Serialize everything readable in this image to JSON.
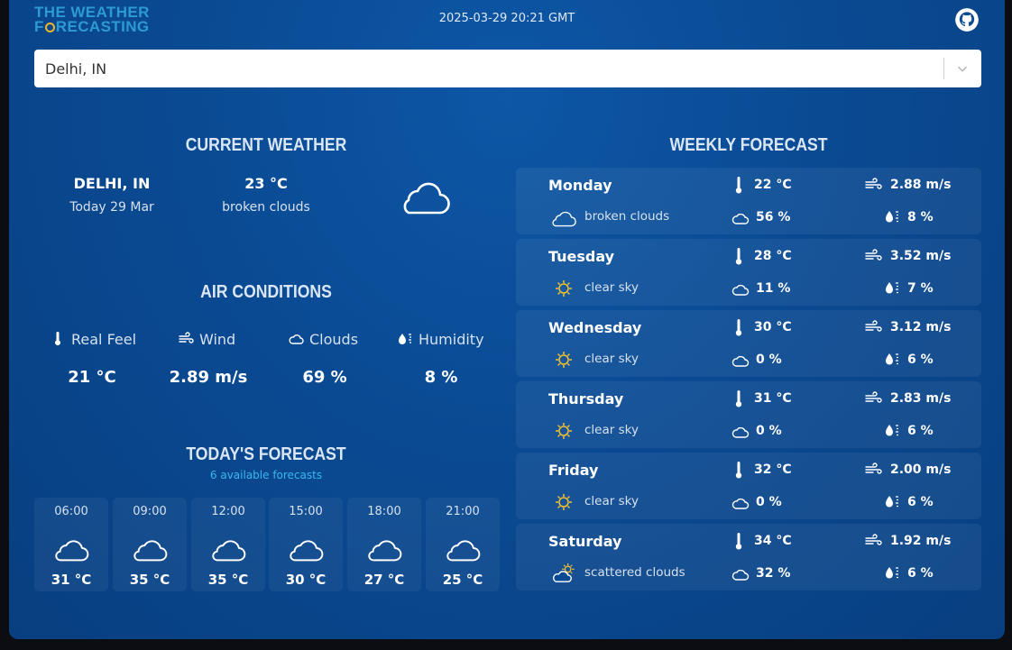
{
  "header": {
    "logo_line1": "THE WEATHER",
    "logo_line2_a": "F",
    "logo_line2_b": "RECASTING",
    "datetime": "2025-03-29 20:21 GMT",
    "github_icon": "github-icon"
  },
  "search": {
    "value": "Delhi, IN",
    "chevron_icon": "chevron-down-icon"
  },
  "current": {
    "title": "CURRENT WEATHER",
    "city": "DELHI, IN",
    "date": "Today 29 Mar",
    "temp": "23 °C",
    "description": "broken clouds",
    "icon": "cloud-icon"
  },
  "air": {
    "title": "AIR CONDITIONS",
    "items": [
      {
        "label": "Real Feel",
        "value": "21 °C",
        "icon": "thermometer-icon"
      },
      {
        "label": "Wind",
        "value": "2.89 m/s",
        "icon": "wind-icon"
      },
      {
        "label": "Clouds",
        "value": "69 %",
        "icon": "cloud-icon"
      },
      {
        "label": "Humidity",
        "value": "8 %",
        "icon": "humidity-icon"
      }
    ]
  },
  "today": {
    "title": "TODAY'S FORECAST",
    "subtitle": "6 available forecasts",
    "hours": [
      {
        "time": "06:00",
        "temp": "31 °C",
        "icon": "cloud-icon"
      },
      {
        "time": "09:00",
        "temp": "35 °C",
        "icon": "cloud-icon"
      },
      {
        "time": "12:00",
        "temp": "35 °C",
        "icon": "cloud-icon"
      },
      {
        "time": "15:00",
        "temp": "30 °C",
        "icon": "cloud-icon"
      },
      {
        "time": "18:00",
        "temp": "27 °C",
        "icon": "cloud-icon"
      },
      {
        "time": "21:00",
        "temp": "25 °C",
        "icon": "cloud-icon"
      }
    ]
  },
  "weekly": {
    "title": "WEEKLY FORECAST",
    "days": [
      {
        "name": "Monday",
        "temp": "22 °C",
        "wind": "2.88 m/s",
        "description": "broken clouds",
        "clouds": "56 %",
        "humidity": "8 %",
        "icon": "cloud-icon"
      },
      {
        "name": "Tuesday",
        "temp": "28 °C",
        "wind": "3.52 m/s",
        "description": "clear sky",
        "clouds": "11 %",
        "humidity": "7 %",
        "icon": "sun-icon"
      },
      {
        "name": "Wednesday",
        "temp": "30 °C",
        "wind": "3.12 m/s",
        "description": "clear sky",
        "clouds": "0 %",
        "humidity": "6 %",
        "icon": "sun-icon"
      },
      {
        "name": "Thursday",
        "temp": "31 °C",
        "wind": "2.83 m/s",
        "description": "clear sky",
        "clouds": "0 %",
        "humidity": "6 %",
        "icon": "sun-icon"
      },
      {
        "name": "Friday",
        "temp": "32 °C",
        "wind": "2.00 m/s",
        "description": "clear sky",
        "clouds": "0 %",
        "humidity": "6 %",
        "icon": "sun-icon"
      },
      {
        "name": "Saturday",
        "temp": "34 °C",
        "wind": "1.92 m/s",
        "description": "scattered clouds",
        "clouds": "32 %",
        "humidity": "6 %",
        "icon": "sun-cloud-icon"
      }
    ]
  }
}
